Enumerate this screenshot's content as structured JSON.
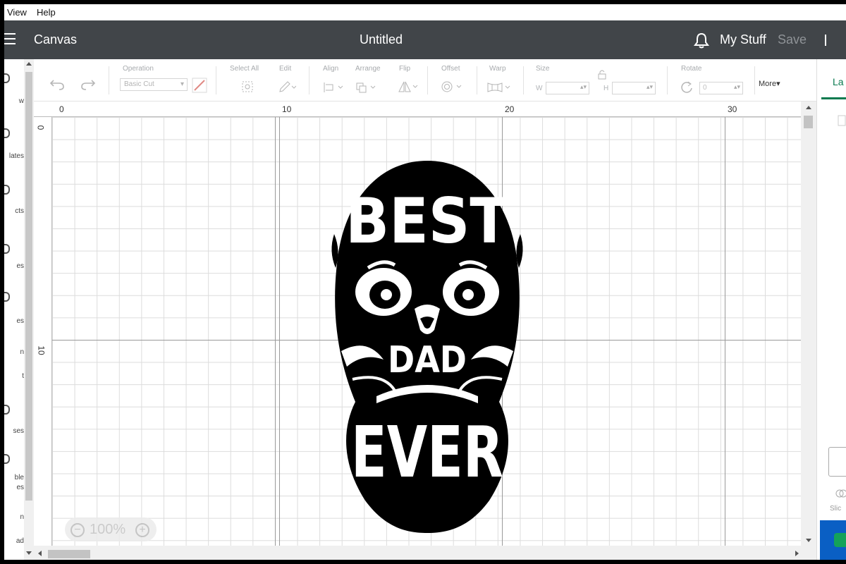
{
  "menubar": {
    "items": [
      "View",
      "Help"
    ]
  },
  "header": {
    "app_name": "Canvas",
    "doc_title": "Untitled",
    "my_stuff": "My Stuff",
    "save": "Save"
  },
  "rail": {
    "items": [
      "w",
      "lates",
      "cts",
      "es",
      "es",
      "n",
      "t",
      "ses",
      "ble",
      "es",
      "n",
      "ad"
    ]
  },
  "toolbar": {
    "operation_label": "Operation",
    "operation_value": "Basic Cut",
    "select_all": "Select All",
    "edit": "Edit",
    "align": "Align",
    "arrange": "Arrange",
    "flip": "Flip",
    "offset": "Offset",
    "warp": "Warp",
    "size": "Size",
    "size_w": "W",
    "size_h": "H",
    "rotate": "Rotate",
    "rotate_value": "0",
    "more": "More"
  },
  "rulers": {
    "top": [
      "0",
      "10",
      "20",
      "30"
    ],
    "left": [
      "0",
      "10"
    ]
  },
  "design": {
    "words": [
      "BEST",
      "DAD",
      "EVER"
    ]
  },
  "zoom": {
    "minus": "−",
    "value": "100%",
    "plus": "+"
  },
  "right_panel": {
    "tab": "La",
    "slice": "Slic"
  },
  "colors": {
    "header_bg": "#414549",
    "accent": "#0a7a4f",
    "design_fill": "#000000"
  }
}
